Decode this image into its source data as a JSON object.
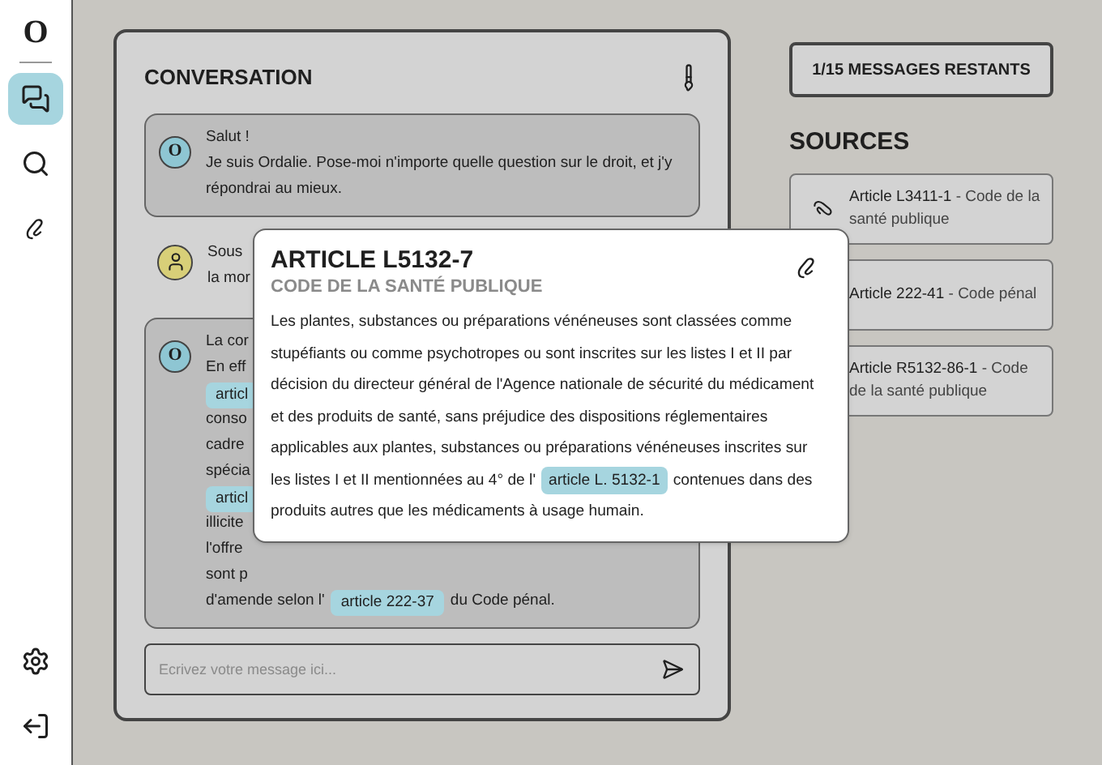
{
  "sidebar": {
    "logo": "O",
    "items": [
      {
        "kind": "chat",
        "selected": true
      },
      {
        "kind": "search",
        "selected": false
      },
      {
        "kind": "sources",
        "selected": false
      }
    ],
    "bottom_items": [
      {
        "kind": "settings"
      },
      {
        "kind": "logout"
      }
    ]
  },
  "conversation": {
    "title": "CONVERSATION",
    "messages": [
      {
        "kind": "bot",
        "avatar": "O",
        "lines": [
          [
            {
              "kind": "text",
              "text": "Salut !"
            }
          ],
          [
            {
              "kind": "text",
              "text": "Je suis Ordalie. Pose-moi n'importe quelle question sur le droit, et j'y"
            }
          ],
          [
            {
              "kind": "text",
              "text": "répondrai au mieux."
            }
          ]
        ]
      },
      {
        "kind": "user",
        "lines": [
          [
            {
              "kind": "text",
              "text": "Sous"
            }
          ],
          [
            {
              "kind": "text",
              "text": "la mor"
            }
          ]
        ]
      },
      {
        "kind": "bot",
        "avatar": "O",
        "lines": [
          [
            {
              "kind": "text",
              "text": "La cor"
            }
          ],
          [
            {
              "kind": "text",
              "text": "En eff"
            }
          ],
          [
            {
              "kind": "link",
              "text": "articl"
            }
          ],
          [
            {
              "kind": "text",
              "text": "conso"
            }
          ],
          [
            {
              "kind": "text",
              "text": "cadre"
            }
          ],
          [
            {
              "kind": "text",
              "text": "spécia"
            }
          ],
          [
            {
              "kind": "link",
              "text": "articl"
            }
          ],
          [
            {
              "kind": "text",
              "text": "illicite"
            }
          ],
          [
            {
              "kind": "text",
              "text": "l'offre"
            }
          ],
          [
            {
              "kind": "text",
              "text": "sont p"
            }
          ],
          [
            {
              "kind": "text",
              "text": "d'amende selon l'"
            },
            {
              "kind": "link",
              "text": "article 222-37"
            },
            {
              "kind": "text",
              "text": "du Code pénal."
            }
          ]
        ]
      }
    ],
    "input": {
      "placeholder": "Ecrivez votre message ici..."
    }
  },
  "quota": "1/15 MESSAGES RESTANTS",
  "sources": {
    "title": "SOURCES",
    "items": [
      {
        "article": "Article L3411-1",
        "code": " - Code de la santé publique",
        "icon": true
      },
      {
        "article": "Article 222-41",
        "code": " - Code pénal"
      },
      {
        "article": "Article R5132-86-1",
        "code": " - Code de la santé publique"
      }
    ]
  },
  "popup": {
    "title": "ARTICLE L5132-7",
    "subtitle": "CODE DE LA SANTÉ PUBLIQUE",
    "body": [
      {
        "kind": "text",
        "text": "Les plantes, substances ou préparations vénéneuses sont classées comme stupéfiants ou comme psychotropes ou sont inscrites sur les listes I et II par décision du directeur général de l'Agence nationale de sécurité du médicament et des produits de santé, sans préjudice des dispositions réglementaires applicables aux plantes, substances ou préparations vénéneuses inscrites sur les listes I et II mentionnées au 4° de l'"
      },
      {
        "kind": "link",
        "text": "article L. 5132-1"
      },
      {
        "kind": "text",
        "text": "contenues dans des produits autres que les médicaments à usage humain."
      }
    ]
  }
}
